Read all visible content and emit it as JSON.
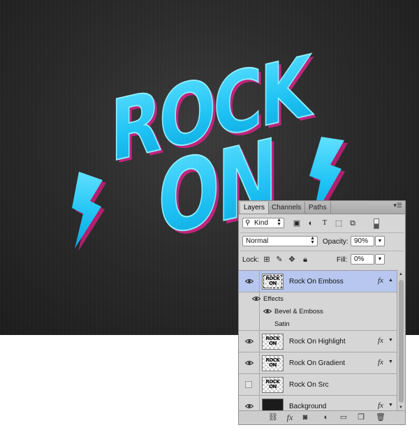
{
  "artwork": {
    "line1": "ROCK",
    "line2": "ON"
  },
  "panel": {
    "tabs": [
      {
        "label": "Layers",
        "active": true
      },
      {
        "label": "Channels",
        "active": false
      },
      {
        "label": "Paths",
        "active": false
      }
    ],
    "filter": {
      "label": "Kind"
    },
    "blend_mode": "Normal",
    "opacity": {
      "label": "Opacity:",
      "value": "90%"
    },
    "lock": {
      "label": "Lock:"
    },
    "fill": {
      "label": "Fill:",
      "value": "0%"
    },
    "layers": [
      {
        "name": "Rock On Emboss",
        "visible": true,
        "selected": true,
        "fx": true
      },
      {
        "name": "Rock On Highlight",
        "visible": true,
        "selected": false,
        "fx": true
      },
      {
        "name": "Rock On Gradient",
        "visible": true,
        "selected": false,
        "fx": true
      },
      {
        "name": "Rock On Src",
        "visible": false,
        "selected": false,
        "fx": false
      },
      {
        "name": "Background",
        "visible": true,
        "selected": false,
        "fx": true
      }
    ],
    "effects": {
      "header": "Effects",
      "items": [
        "Bevel & Emboss",
        "Satin"
      ]
    },
    "fx_symbol": "fx",
    "thumb_text": "ROCK ON"
  },
  "colors": {
    "text_cyan": "#1fc3f4",
    "text_magenta": "#d0237f",
    "panel_bg": "#d6d6d6",
    "selected_layer": "#b7c7ef"
  }
}
